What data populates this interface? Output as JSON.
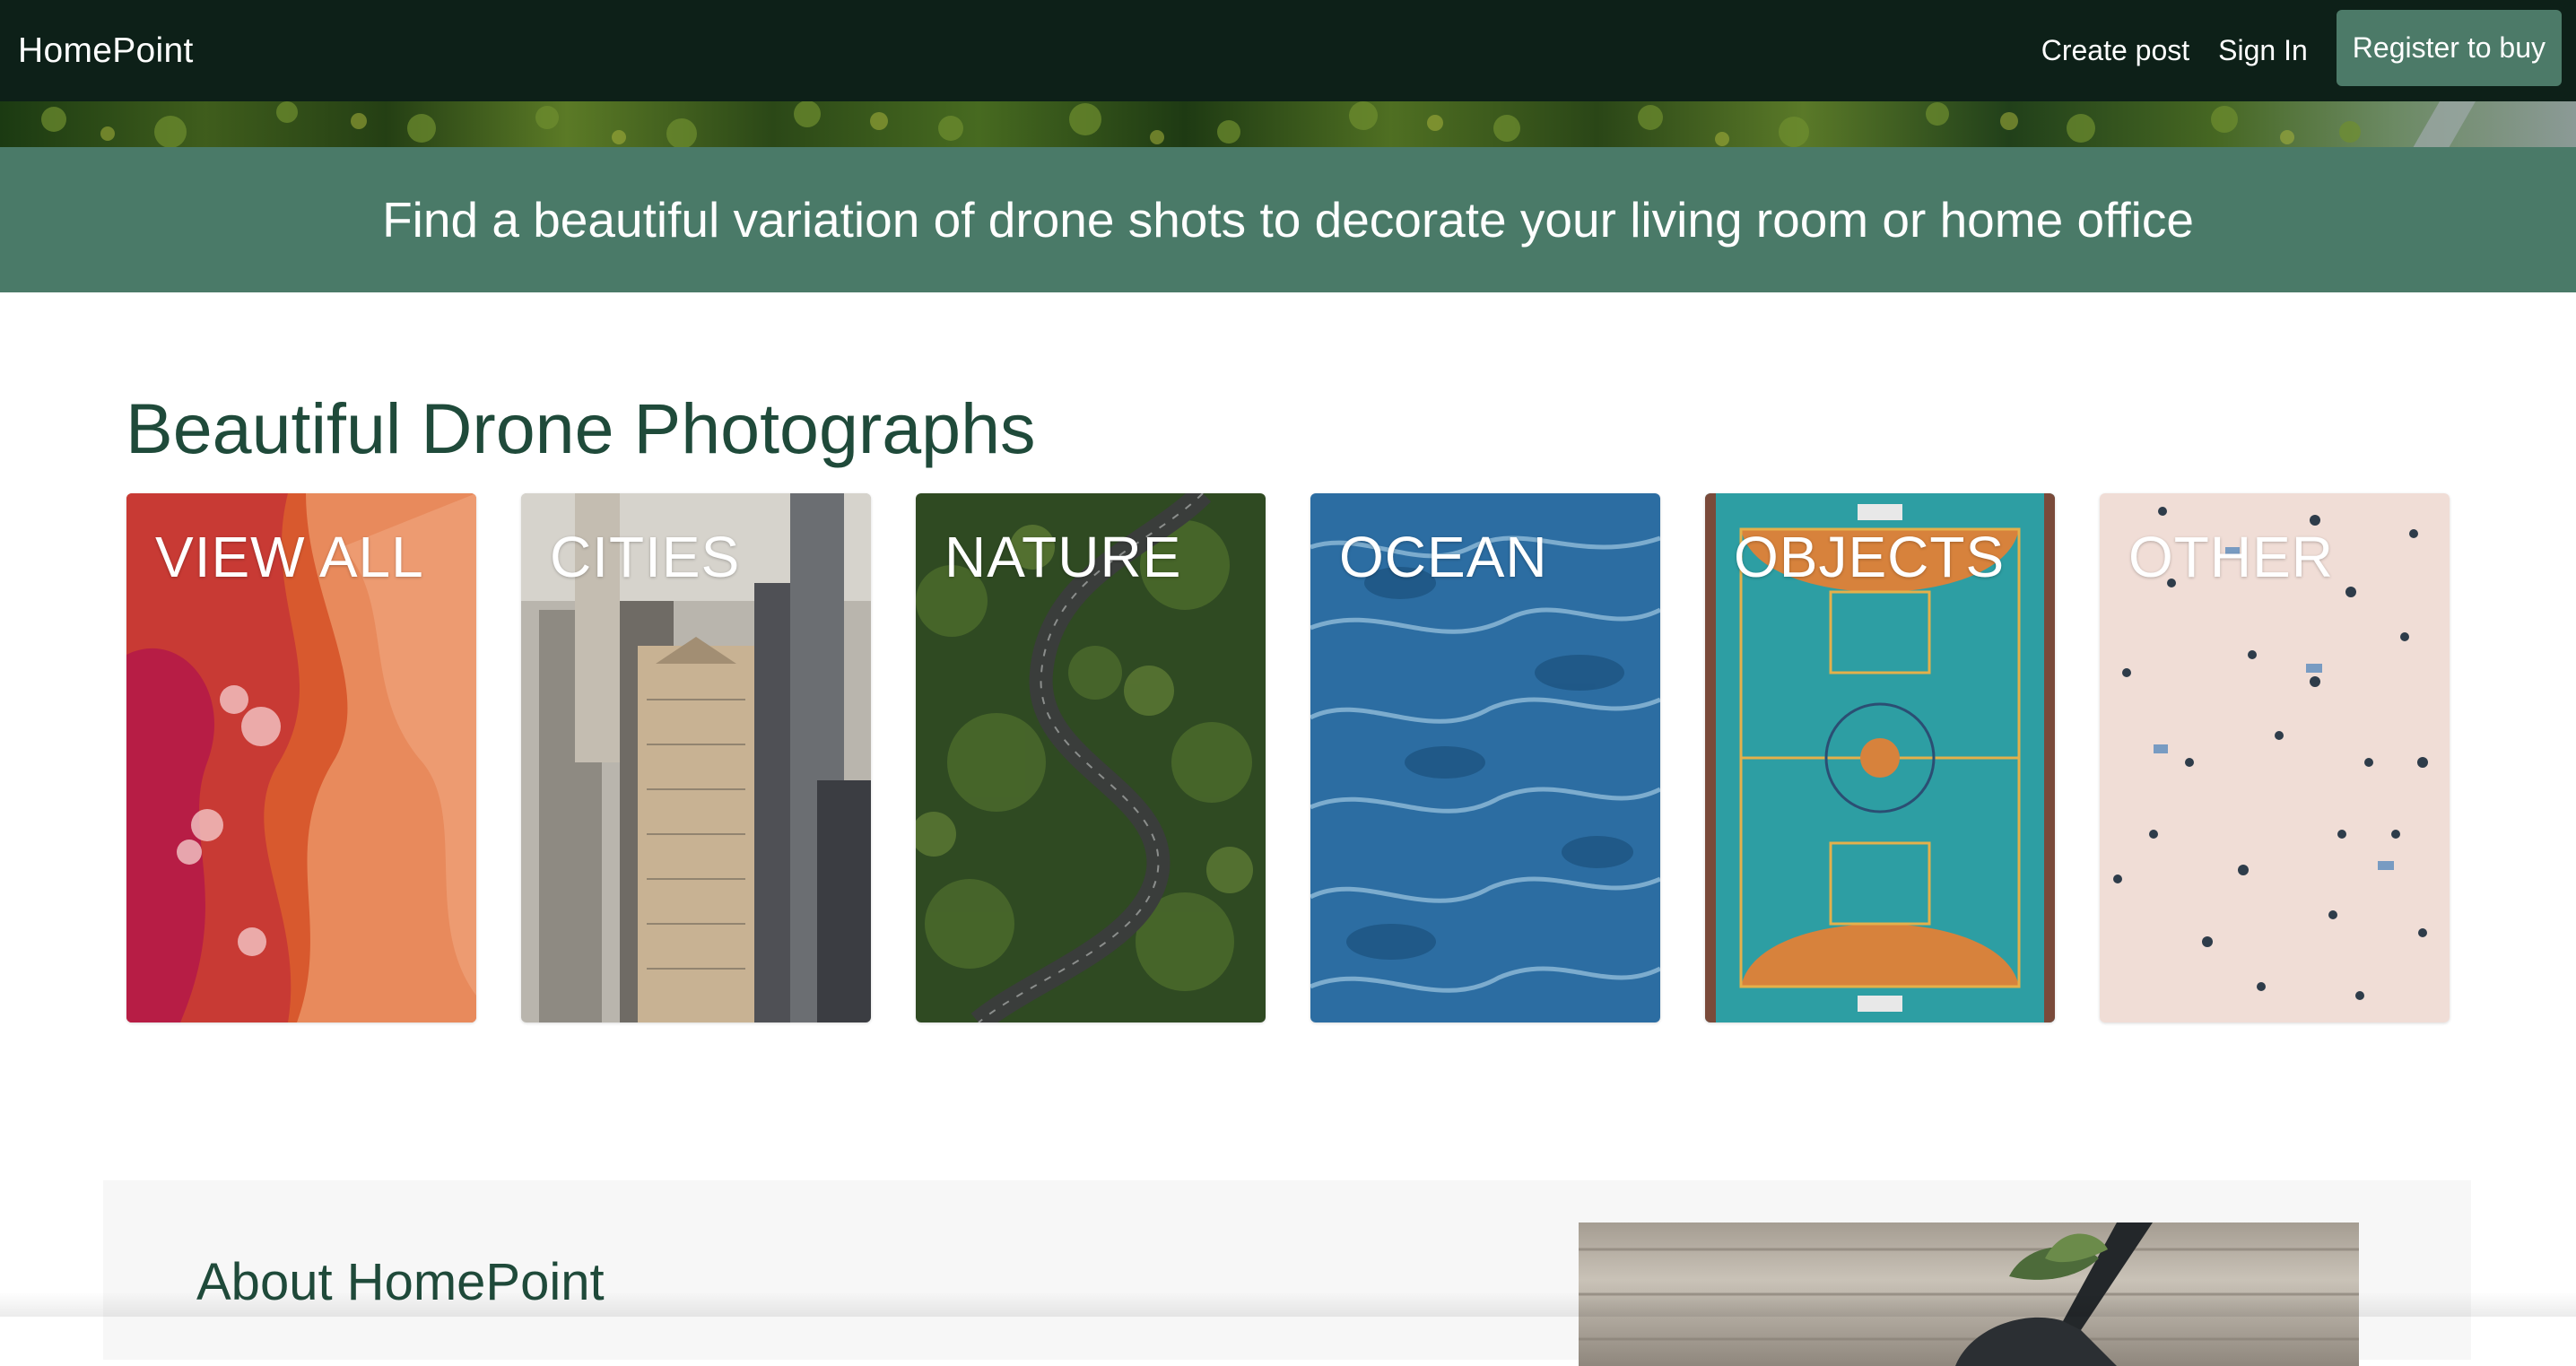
{
  "navbar": {
    "brand": "HomePoint",
    "links": {
      "create_post": "Create post",
      "sign_in": "Sign In"
    },
    "register_button": "Register to buy"
  },
  "banner": {
    "text": "Find a beautiful variation of drone shots to decorate your living room or home office"
  },
  "gallery": {
    "title": "Beautiful Drone Photographs",
    "categories": [
      "VIEW ALL",
      "CITIES",
      "NATURE",
      "OCEAN",
      "OBJECTS",
      "OTHER"
    ]
  },
  "about": {
    "title": "About HomePoint"
  },
  "colors": {
    "nav_bg": "#0d2018",
    "banner_bg": "#4a7a68",
    "heading": "#1f4a3a",
    "button_bg": "#4c7a68"
  }
}
